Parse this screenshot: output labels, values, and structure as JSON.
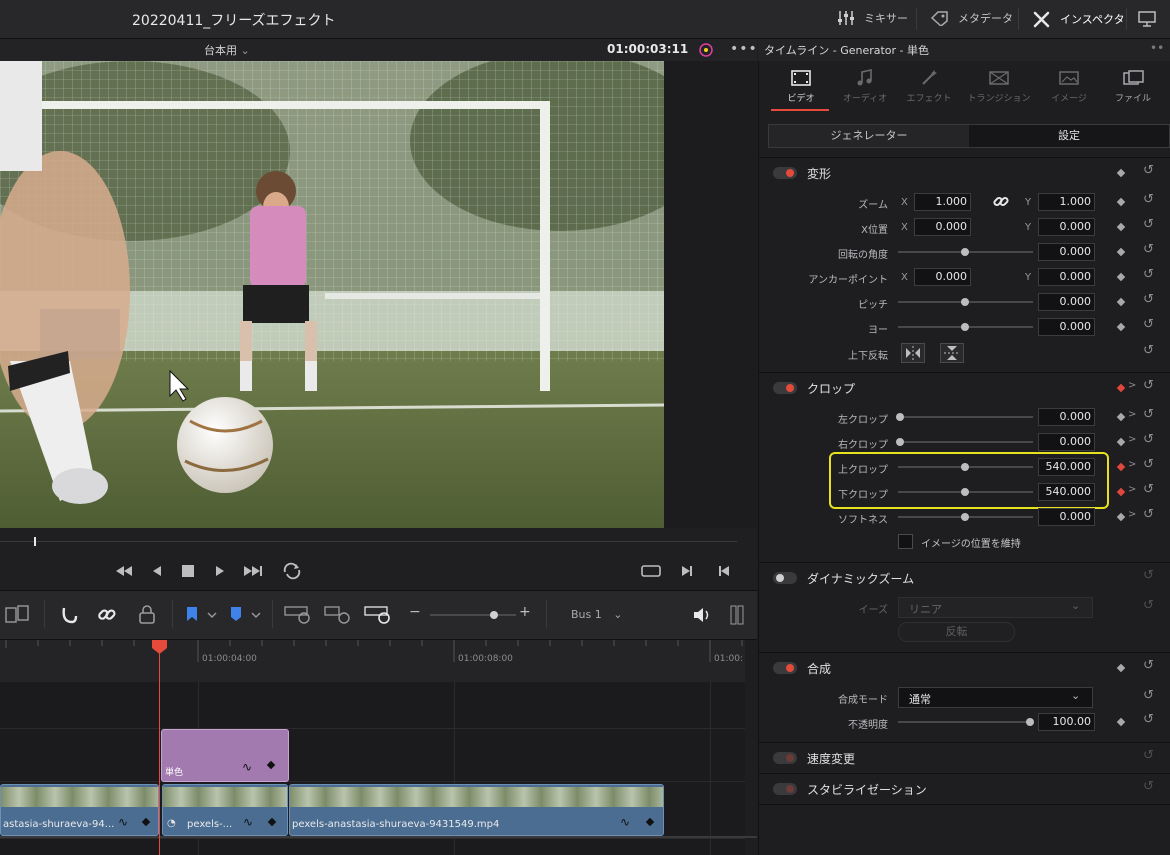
{
  "project": {
    "title": "20220411_フリーズエフェクト"
  },
  "top_buttons": {
    "mixer": "ミキサー",
    "metadata": "メタデータ",
    "inspector": "インスペクタ"
  },
  "viewer": {
    "clip_name": "台本用",
    "timecode": "01:00:03:11"
  },
  "inspector": {
    "header": "タイムライン - Generator - 単色",
    "tabs": [
      "ビデオ",
      "オーディオ",
      "エフェクト",
      "トランジション",
      "イメージ",
      "ファイル"
    ],
    "segments": [
      "ジェネレーター",
      "設定"
    ],
    "transform": {
      "title": "変形",
      "zoom_label": "ズーム",
      "zoom_x": "1.000",
      "zoom_y": "1.000",
      "pos_label": "X位置",
      "pos_x": "0.000",
      "pos_y": "0.000",
      "rotation_label": "回転の角度",
      "rotation": "0.000",
      "anchor_label": "アンカーポイント",
      "anchor_x": "0.000",
      "anchor_y": "0.000",
      "pitch_label": "ピッチ",
      "pitch": "0.000",
      "yaw_label": "ヨー",
      "yaw": "0.000",
      "flip_label": "上下反転",
      "x": "X",
      "y": "Y"
    },
    "crop": {
      "title": "クロップ",
      "left_label": "左クロップ",
      "left": "0.000",
      "right_label": "右クロップ",
      "right": "0.000",
      "top_label": "上クロップ",
      "top": "540.000",
      "bottom_label": "下クロップ",
      "bottom": "540.000",
      "soft_label": "ソフトネス",
      "soft": "0.000",
      "retain_label": "イメージの位置を維持"
    },
    "dynamic_zoom": {
      "title": "ダイナミックズーム",
      "ease_label": "イーズ",
      "ease_value": "リニア",
      "swap": "反転"
    },
    "composite": {
      "title": "合成",
      "mode_label": "合成モード",
      "mode_value": "通常",
      "opacity_label": "不透明度",
      "opacity": "100.00"
    },
    "speed": {
      "title": "速度変更"
    },
    "stabilization": {
      "title": "スタビライゼーション"
    }
  },
  "timeline": {
    "bus": "Bus 1",
    "ruler_ticks": [
      "01:00:04:00",
      "01:00:08:00",
      "01:00:"
    ],
    "clips": {
      "solid_label": "単色",
      "clip_a": "astasia-shuraeva-94...",
      "clip_b": "pexels-...",
      "clip_c": "pexels-anastasia-shuraeva-9431549.mp4"
    }
  }
}
